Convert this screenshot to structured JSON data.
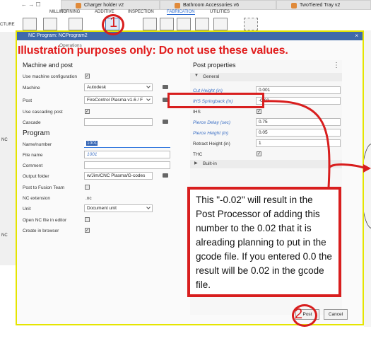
{
  "tabs": [
    {
      "label": "Charger holder v2"
    },
    {
      "label": "Bathroom Accessories v6"
    },
    {
      "label": "TwoTiered Tray v2"
    }
  ],
  "ribbon": {
    "menus": [
      "MILLING",
      "TURNING",
      "ADDITIVE",
      "INSPECTION",
      "FABRICATION",
      "UTILITIES"
    ],
    "left_cut_label": "CTURE"
  },
  "dialog": {
    "title": "NC Program: NCProgram2",
    "close": "×",
    "tab_label": "Operations",
    "machine_section": "Machine and post",
    "use_machine_config_label": "Use machine configuration",
    "machine_label": "Machine",
    "machine_value": "Autodesk",
    "post_label": "Post",
    "post_value": "FireControl Plasma v1.6 / F",
    "use_cascading_label": "Use cascading post",
    "cascade_label": "Cascade",
    "cascade_value": "",
    "program_section": "Program",
    "name_number_label": "Name/number",
    "name_number_value": "1001",
    "file_name_label": "File name",
    "file_name_value": "1001",
    "comment_label": "Comment",
    "comment_value": "",
    "output_folder_label": "Output folder",
    "output_folder_value": "w/Jim/CNC Plasma/G-codes",
    "post_fusion_label": "Post to Fusion Team",
    "nc_extension_label": "NC extension",
    "nc_extension_value": ".nc",
    "unit_label": "Unit",
    "unit_value": "Document unit",
    "open_nc_label": "Open NC file in editor",
    "create_browser_label": "Create in browser",
    "post_props_title": "Post properties",
    "general_label": "General",
    "props": [
      {
        "label": "Cut Height (in)",
        "value": "0.001"
      },
      {
        "label": "IHS Springback (in)",
        "value": "-0.02"
      },
      {
        "label": "IHS",
        "value": ""
      },
      {
        "label": "Pierce Delay (sec)",
        "value": "0.75"
      },
      {
        "label": "Pierce Height (in)",
        "value": "0.05"
      },
      {
        "label": "Retract Height (in)",
        "value": "1"
      },
      {
        "label": "THC",
        "value": ""
      }
    ],
    "builtin_label": "Built-in",
    "post_button": "Post",
    "cancel_button": "Cancel",
    "menu_dots": "⋮",
    "check_mark": "✓"
  },
  "annotations": {
    "warning": "Illustration purposes only: Do not use these values.",
    "callout": "This \"-0.02\" will result in the Post Processor of adding this number to the 0.02 that it is alreading planning to put in the gcode file. If you entered 0.0 the result will be 0.02 in the gcode file.",
    "circle1": "1",
    "circle2": "2"
  },
  "tree_labels": [
    "CTURE",
    "NC",
    "NC"
  ]
}
